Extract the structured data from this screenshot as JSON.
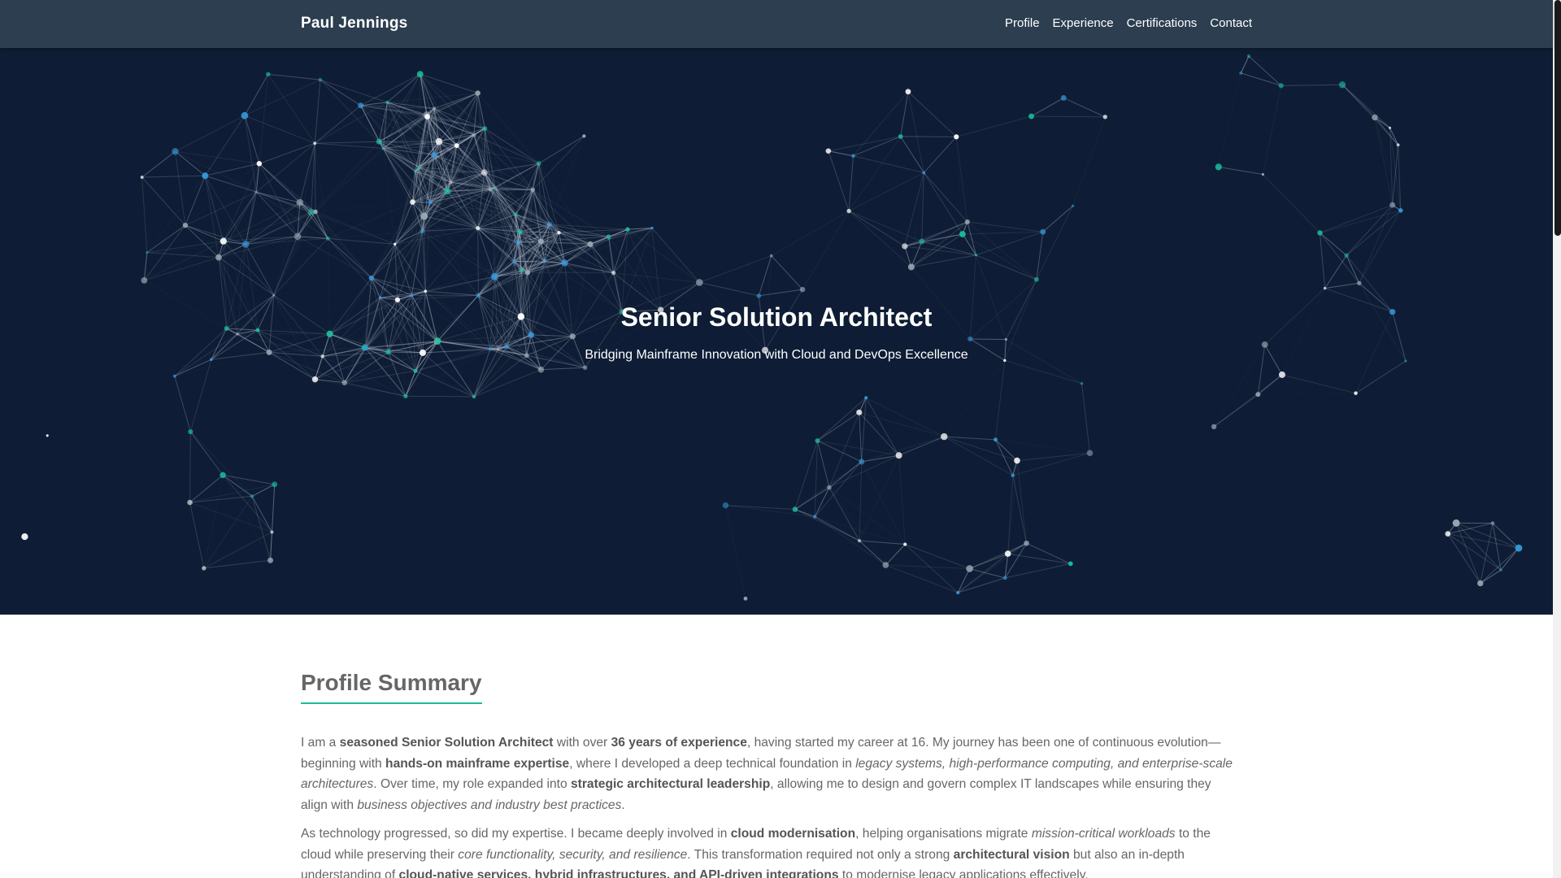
{
  "nav": {
    "brand": "Paul Jennings",
    "links": [
      "Profile",
      "Experience",
      "Certifications",
      "Contact"
    ]
  },
  "hero": {
    "title": "Senior Solution Architect",
    "subtitle": "Bridging Mainframe Innovation with Cloud and DevOps Excellence"
  },
  "profile": {
    "title": "Profile Summary",
    "p1": [
      {
        "t": "I am a "
      },
      {
        "t": "seasoned Senior Solution Architect",
        "b": true
      },
      {
        "t": " with over "
      },
      {
        "t": "36 years of experience",
        "b": true
      },
      {
        "t": ", having started my career at 16. My journey has been one of continuous evolution—beginning with "
      },
      {
        "t": "hands-on mainframe expertise",
        "b": true
      },
      {
        "t": ", where I developed a deep technical foundation in "
      },
      {
        "t": "legacy systems, high-performance computing, and enterprise-scale architectures",
        "i": true
      },
      {
        "t": ". Over time, my role expanded into "
      },
      {
        "t": "strategic architectural leadership",
        "b": true
      },
      {
        "t": ", allowing me to design and govern complex IT landscapes while ensuring they align with "
      },
      {
        "t": "business objectives and industry best practices",
        "i": true
      },
      {
        "t": "."
      }
    ],
    "p2": [
      {
        "t": "As technology progressed, so did my expertise. I became deeply involved in "
      },
      {
        "t": "cloud modernisation",
        "b": true
      },
      {
        "t": ", helping organisations migrate "
      },
      {
        "t": "mission-critical workloads",
        "i": true
      },
      {
        "t": " to the cloud while preserving their "
      },
      {
        "t": "core functionality, security, and resilience",
        "i": true
      },
      {
        "t": ". This transformation required not only a strong "
      },
      {
        "t": "architectural vision",
        "b": true
      },
      {
        "t": " but also an in-depth understanding of "
      },
      {
        "t": "cloud-native services, hybrid infrastructures, and API-driven integrations",
        "b": true
      },
      {
        "t": " to modernise legacy applications effectively."
      }
    ]
  },
  "colors": {
    "navbar": "#2c3e50",
    "hero": "#0e1d35",
    "accent": "#1abc9c",
    "text": "#666666"
  }
}
